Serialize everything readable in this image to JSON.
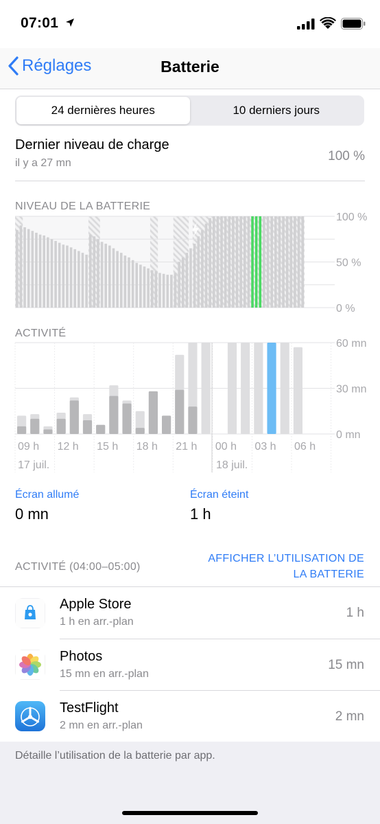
{
  "status_bar": {
    "time": "07:01"
  },
  "nav": {
    "back_label": "Réglages",
    "title": "Batterie"
  },
  "segment": {
    "options": [
      "24 dernières heures",
      "10 derniers jours"
    ],
    "selected": 0
  },
  "last_charge": {
    "label": "Dernier niveau de charge",
    "sub": "il y a 27 mn",
    "value": "100 %"
  },
  "battery_section": {
    "title": "NIVEAU DE LA BATTERIE"
  },
  "activity_section": {
    "title": "ACTIVITÉ"
  },
  "colors": {
    "accent": "#2f7cf6",
    "selected_activity": "#6cbcf5",
    "charge_full": "#4cd964",
    "bar": "#d1d1d3",
    "bar_dark": "#b7b7b9"
  },
  "chart_data": [
    {
      "type": "bar",
      "title": "NIVEAU DE LA BATTERIE",
      "y_ticks": [
        "100 %",
        "50 %",
        "0 %"
      ],
      "ylim": [
        0,
        100
      ],
      "values": [
        85,
        90,
        88,
        86,
        84,
        82,
        80,
        79,
        77,
        75,
        73,
        71,
        69,
        68,
        66,
        64,
        62,
        60,
        58,
        80,
        78,
        75,
        72,
        70,
        68,
        65,
        62,
        60,
        57,
        55,
        52,
        49,
        47,
        45,
        43,
        41,
        40,
        38,
        37,
        36,
        36,
        38,
        50,
        55,
        60,
        65,
        70,
        78,
        85,
        92,
        98,
        100,
        100,
        100,
        100,
        100,
        100,
        100,
        100,
        100,
        100,
        100,
        100,
        100,
        100,
        100,
        100,
        100,
        100,
        100,
        100,
        100,
        100,
        100,
        100
      ],
      "charging_ranges": [
        [
          0,
          2
        ],
        [
          19,
          22
        ],
        [
          35,
          37
        ],
        [
          41,
          45
        ],
        [
          46,
          75
        ]
      ],
      "full_charge_highlight": [
        61,
        64
      ]
    },
    {
      "type": "bar",
      "title": "ACTIVITÉ",
      "y_ticks": [
        "60 mn",
        "30 mn",
        "0 mn"
      ],
      "ylim": [
        0,
        60
      ],
      "x_ticks": [
        "09 h",
        "12 h",
        "15 h",
        "18 h",
        "21 h",
        "00 h",
        "03 h",
        "06 h"
      ],
      "date_labels": [
        "17 juil.",
        "18 juil."
      ],
      "series": [
        {
          "name": "Écran allumé",
          "values": [
            5,
            10,
            3,
            10,
            22,
            9,
            6,
            25,
            20,
            4,
            28,
            12,
            29,
            18,
            0,
            0,
            0,
            0,
            0,
            0,
            0,
            0
          ]
        },
        {
          "name": "Écran éteint",
          "values": [
            12,
            13,
            5,
            14,
            24,
            13,
            6,
            32,
            22,
            15,
            28,
            12,
            52,
            60,
            60,
            0,
            60,
            60,
            60,
            60,
            60,
            57
          ]
        }
      ],
      "highlight_index": 19
    }
  ],
  "stats": {
    "screen_on": {
      "label": "Écran allumé",
      "value": "0 mn"
    },
    "screen_off": {
      "label": "Écran éteint",
      "value": "1 h"
    }
  },
  "activity_window": {
    "label": "ACTIVITÉ (04:00–05:00)",
    "link_line1": "AFFICHER L’UTILISATION DE",
    "link_line2": "LA BATTERIE"
  },
  "apps": [
    {
      "name": "Apple Store",
      "sub": "1 h en arr.-plan",
      "time": "1 h",
      "icon": "apple-store-icon"
    },
    {
      "name": "Photos",
      "sub": "15 mn en arr.-plan",
      "time": "15 mn",
      "icon": "photos-icon"
    },
    {
      "name": "TestFlight",
      "sub": "2 mn en arr.-plan",
      "time": "2 mn",
      "icon": "testflight-icon"
    }
  ],
  "footer": {
    "text": "Détaille l’utilisation de la batterie par app."
  }
}
